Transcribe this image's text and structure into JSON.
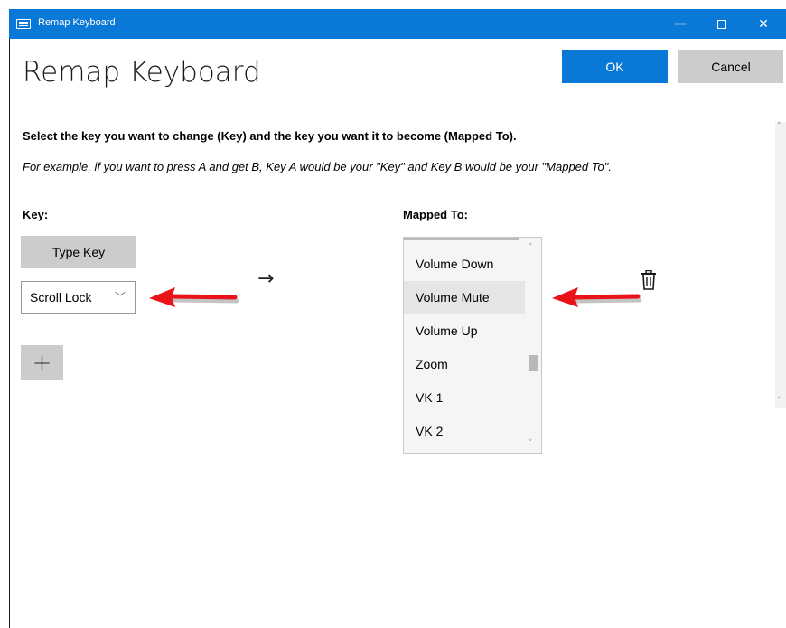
{
  "window": {
    "title": "Remap Keyboard",
    "controls": {
      "minimize": "—",
      "close": "✕"
    }
  },
  "header": {
    "page_title": "Remap Keyboard",
    "ok_label": "OK",
    "cancel_label": "Cancel"
  },
  "instructions": {
    "main": "Select the key you want to change (Key) and the key you want it to become (Mapped To).",
    "example": "For example, if you want to press A and get B, Key A would be your \"Key\" and Key B would be your \"Mapped To\"."
  },
  "key_column": {
    "label": "Key:",
    "type_key_label": "Type Key",
    "selected_key": "Scroll Lock",
    "add_label": "+"
  },
  "mapping_arrow": "→",
  "mapped_column": {
    "label": "Mapped To:",
    "options": [
      "Volume Down",
      "Volume Mute",
      "Volume Up",
      "Zoom",
      "VK 1",
      "VK 2"
    ],
    "selected": "Volume Mute"
  },
  "icons": {
    "app": "keyboard-icon",
    "trash": "trash-icon",
    "annotation": "red-arrow-icon"
  },
  "colors": {
    "accent": "#0a78d7",
    "button_gray": "#cccccc",
    "annotation_red": "#e8141a"
  }
}
